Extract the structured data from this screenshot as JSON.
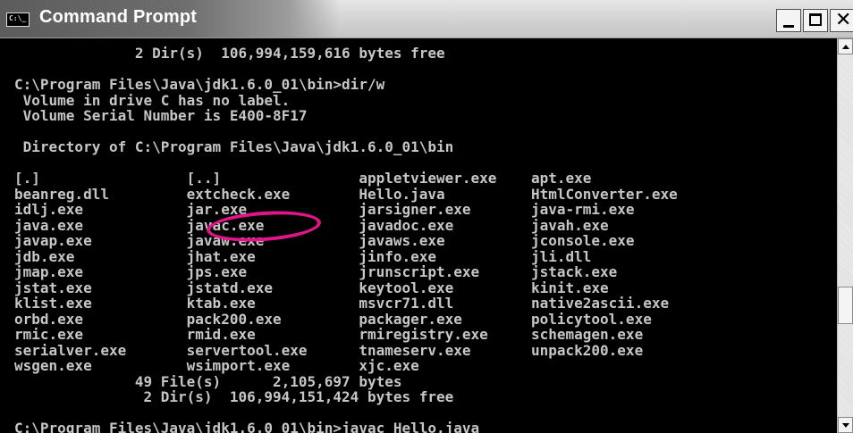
{
  "window": {
    "title": "Command Prompt",
    "icon": "console-icon",
    "icon_text": "C:\\_"
  },
  "controls": {
    "minimize_icon": "minimize-icon",
    "maximize_icon": "maximize-icon",
    "close_icon": "close-icon",
    "close_glyph": "✕"
  },
  "console": {
    "lines": [
      "              2 Dir(s)  106,994,159,616 bytes free",
      "",
      "C:\\Program Files\\Java\\jdk1.6.0_01\\bin>dir/w",
      " Volume in drive C has no label.",
      " Volume Serial Number is E400-8F17",
      "",
      " Directory of C:\\Program Files\\Java\\jdk1.6.0_01\\bin",
      "",
      "[.]                 [..]                appletviewer.exe    apt.exe",
      "beanreg.dll         extcheck.exe        Hello.java          HtmlConverter.exe",
      "idlj.exe            jar.exe             jarsigner.exe       java-rmi.exe",
      "java.exe            javac.exe           javadoc.exe         javah.exe",
      "javap.exe           javaw.exe           javaws.exe          jconsole.exe",
      "jdb.exe             jhat.exe            jinfo.exe           jli.dll",
      "jmap.exe            jps.exe             jrunscript.exe      jstack.exe",
      "jstat.exe           jstatd.exe          keytool.exe         kinit.exe",
      "klist.exe           ktab.exe            msvcr71.dll         native2ascii.exe",
      "orbd.exe            pack200.exe         packager.exe        policytool.exe",
      "rmic.exe            rmid.exe            rmiregistry.exe     schemagen.exe",
      "serialver.exe       servertool.exe      tnameserv.exe       unpack200.exe",
      "wsgen.exe           wsimport.exe        xjc.exe",
      "              49 File(s)      2,105,697 bytes",
      "               2 Dir(s)  106,994,151,424 bytes free",
      "",
      "C:\\Program Files\\Java\\jdk1.6.0_01\\bin>javac Hello.java"
    ],
    "highlight_annotation": "javac.exe"
  },
  "colors": {
    "console_bg": "#000000",
    "console_text": "#c6c6c6",
    "highlight": "#e0158a"
  }
}
